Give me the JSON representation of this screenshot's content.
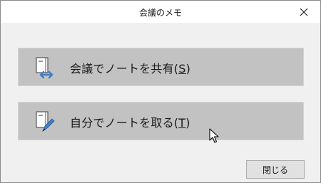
{
  "window": {
    "title": "会議のメモ"
  },
  "actions": [
    {
      "label_before": "会議でノートを共有(",
      "accelerator": "S",
      "label_after": ")",
      "icon": "notebook-share-icon"
    },
    {
      "label_before": "自分でノートを取る(",
      "accelerator": "T",
      "label_after": ")",
      "icon": "notebook-pen-icon"
    }
  ],
  "footer": {
    "close_label": "閉じる"
  },
  "colors": {
    "action_bg": "#c2c2c2",
    "accent_blue": "#3f7fc6",
    "window_bg": "#f0f0f0"
  }
}
